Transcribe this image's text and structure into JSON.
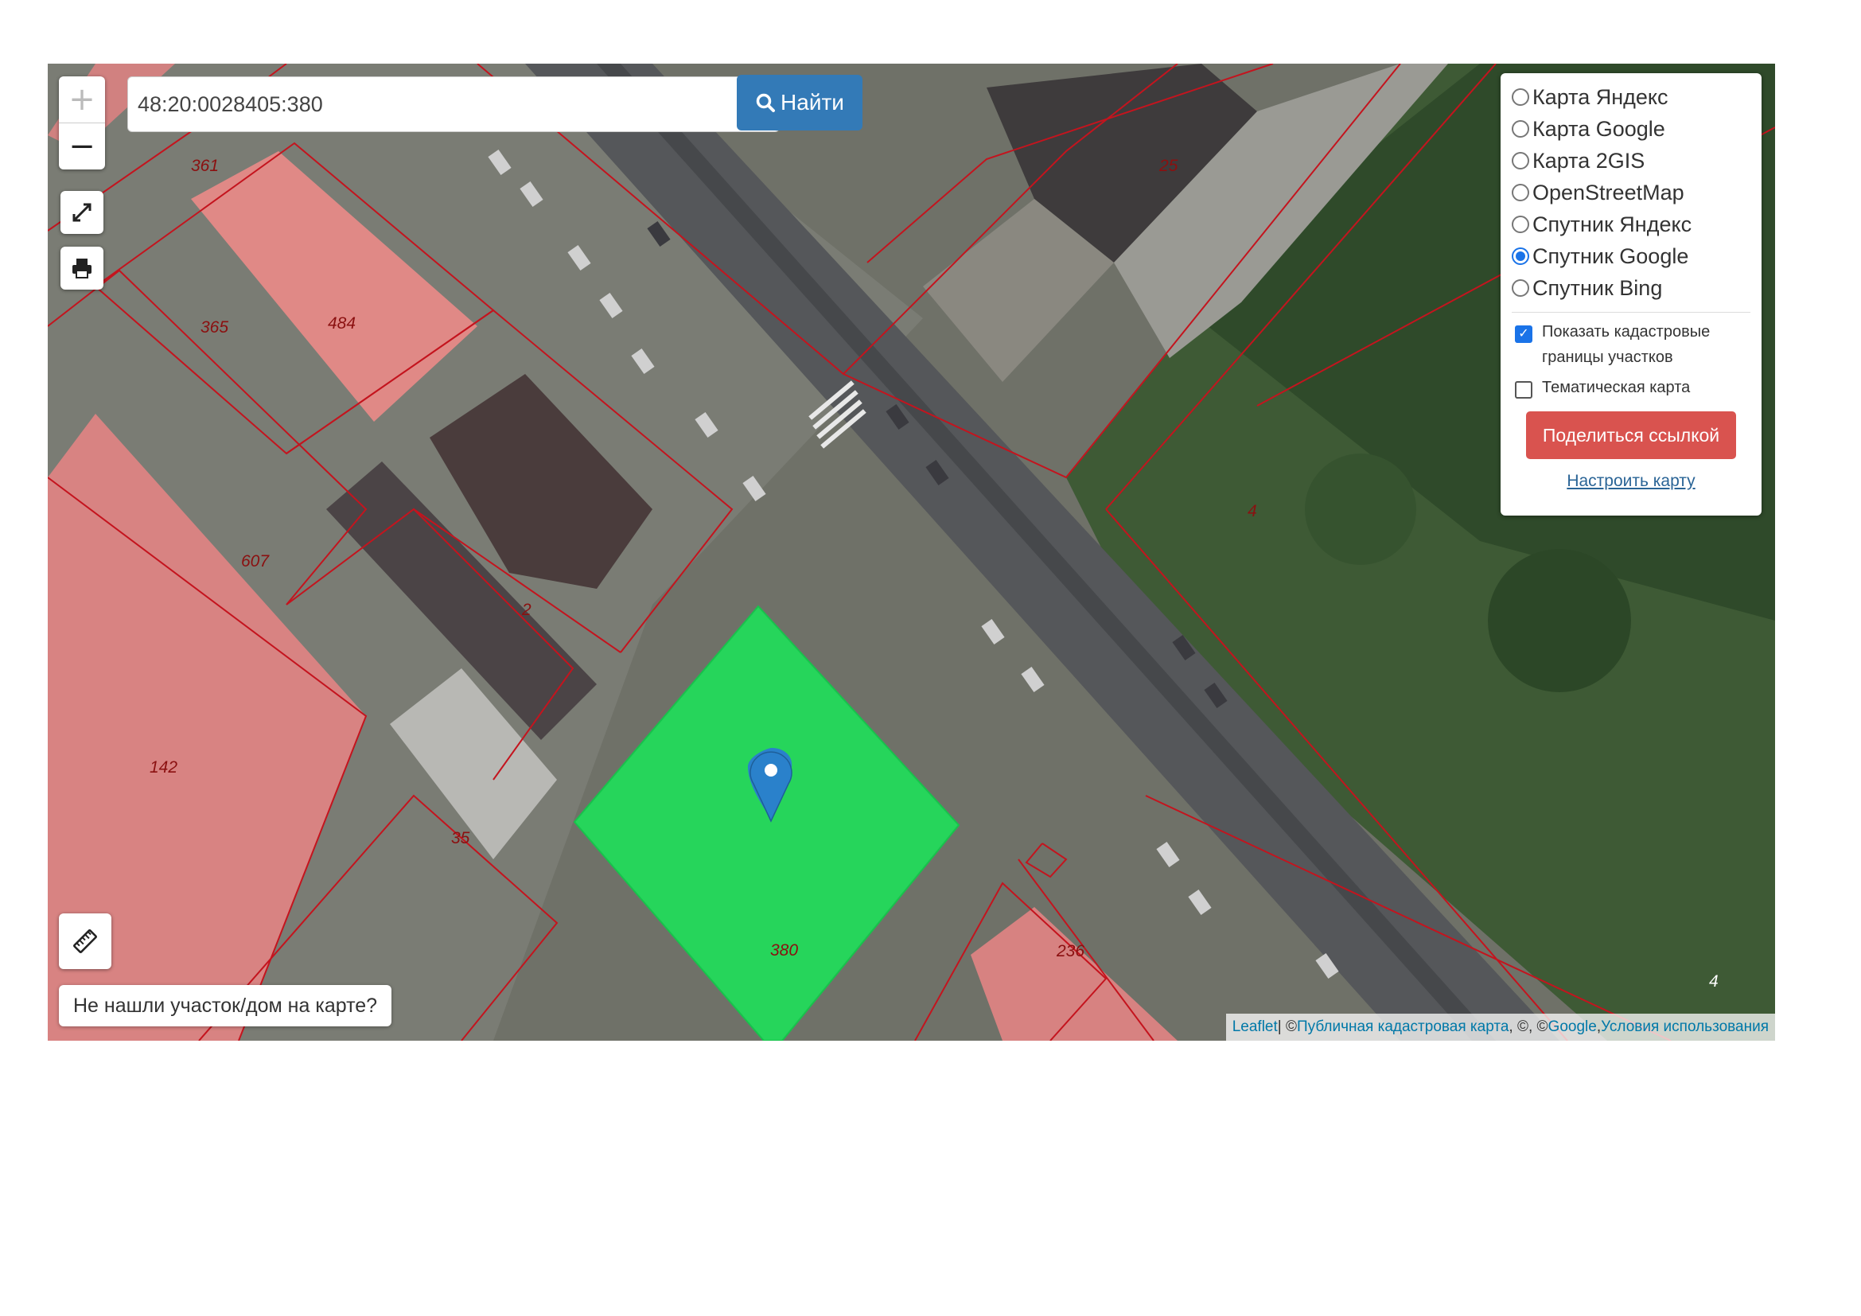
{
  "search": {
    "value": "48:20:0028405:380",
    "button_label": "Найти"
  },
  "zoom": {
    "in_label": "+",
    "out_label": "−"
  },
  "layers": {
    "options": [
      {
        "label": "Карта Яндекс",
        "selected": false
      },
      {
        "label": "Карта Google",
        "selected": false
      },
      {
        "label": "Карта 2GIS",
        "selected": false
      },
      {
        "label": "OpenStreetMap",
        "selected": false
      },
      {
        "label": "Спутник Яндекс",
        "selected": false
      },
      {
        "label": "Спутник Google",
        "selected": true
      },
      {
        "label": "Спутник Bing",
        "selected": false
      }
    ],
    "show_cadastral": {
      "label": "Показать кадастровые границы участков",
      "checked": true
    },
    "thematic": {
      "label": "Тематическая карта",
      "checked": false
    },
    "share_label": "Поделиться ссылкой",
    "configure_label": "Настроить карту"
  },
  "not_found_label": "Не нашли участок/дом на карте?",
  "attribution": {
    "leaflet": "Leaflet",
    "sep1": " | © ",
    "pkk": "Публичная кадастровая карта",
    "sep2": ", ©, © ",
    "google": "Google",
    "sep3": ", ",
    "terms": "Условия использования"
  },
  "parcel_labels": [
    "361",
    "365",
    "484",
    "25",
    "607",
    "2",
    "4",
    "142",
    "35",
    "380",
    "236",
    "4"
  ],
  "colors": {
    "selected_parcel": "#1ee05a",
    "parcel_border": "#c4141e",
    "building_highlight": "#e88a88",
    "button_primary": "#337ab7",
    "button_danger": "#d9534f"
  }
}
